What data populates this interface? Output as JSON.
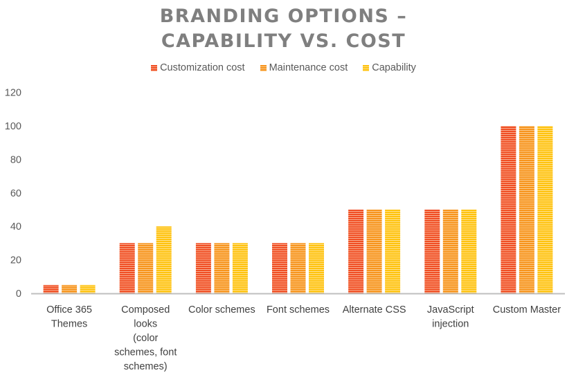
{
  "chart_data": {
    "type": "bar",
    "title_lines": [
      "BRANDING OPTIONS –",
      "CAPABILITY VS. COST"
    ],
    "xlabel": "",
    "ylabel": "",
    "ylim": [
      0,
      120
    ],
    "yticks": [
      0,
      20,
      40,
      60,
      80,
      100,
      120
    ],
    "grid": false,
    "legend_position": "top",
    "categories": [
      [
        "Office 365",
        "Themes"
      ],
      [
        "Composed",
        "looks",
        "(color",
        "schemes, font",
        "schemes)"
      ],
      [
        "Color schemes"
      ],
      [
        "Font schemes"
      ],
      [
        "Alternate CSS"
      ],
      [
        "JavaScript",
        "injection"
      ],
      [
        "Custom Master"
      ]
    ],
    "series": [
      {
        "name": "Customization cost",
        "color": "#F04E23",
        "stripe": "#F9AE92",
        "values": [
          5,
          30,
          30,
          30,
          50,
          50,
          100
        ]
      },
      {
        "name": "Maintenance cost",
        "color": "#F7941D",
        "stripe": "#FBCB8C",
        "values": [
          5,
          30,
          30,
          30,
          50,
          50,
          100
        ]
      },
      {
        "name": "Capability",
        "color": "#FFC20E",
        "stripe": "#FFE38F",
        "values": [
          5,
          40,
          30,
          30,
          50,
          50,
          100
        ]
      }
    ]
  }
}
